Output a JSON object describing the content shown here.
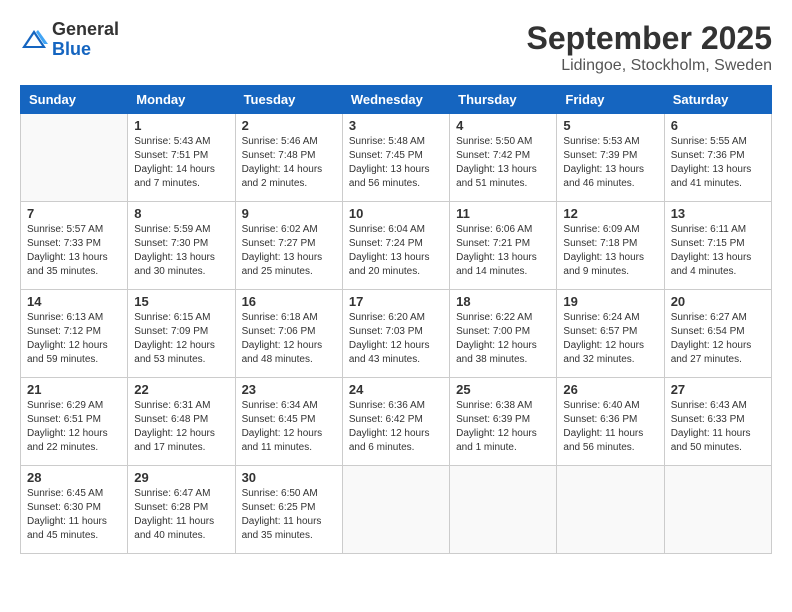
{
  "logo": {
    "general": "General",
    "blue": "Blue"
  },
  "title": "September 2025",
  "location": "Lidingoe, Stockholm, Sweden",
  "weekdays": [
    "Sunday",
    "Monday",
    "Tuesday",
    "Wednesday",
    "Thursday",
    "Friday",
    "Saturday"
  ],
  "weeks": [
    [
      {
        "day": "",
        "sunrise": "",
        "sunset": "",
        "daylight": ""
      },
      {
        "day": "1",
        "sunrise": "Sunrise: 5:43 AM",
        "sunset": "Sunset: 7:51 PM",
        "daylight": "Daylight: 14 hours and 7 minutes."
      },
      {
        "day": "2",
        "sunrise": "Sunrise: 5:46 AM",
        "sunset": "Sunset: 7:48 PM",
        "daylight": "Daylight: 14 hours and 2 minutes."
      },
      {
        "day": "3",
        "sunrise": "Sunrise: 5:48 AM",
        "sunset": "Sunset: 7:45 PM",
        "daylight": "Daylight: 13 hours and 56 minutes."
      },
      {
        "day": "4",
        "sunrise": "Sunrise: 5:50 AM",
        "sunset": "Sunset: 7:42 PM",
        "daylight": "Daylight: 13 hours and 51 minutes."
      },
      {
        "day": "5",
        "sunrise": "Sunrise: 5:53 AM",
        "sunset": "Sunset: 7:39 PM",
        "daylight": "Daylight: 13 hours and 46 minutes."
      },
      {
        "day": "6",
        "sunrise": "Sunrise: 5:55 AM",
        "sunset": "Sunset: 7:36 PM",
        "daylight": "Daylight: 13 hours and 41 minutes."
      }
    ],
    [
      {
        "day": "7",
        "sunrise": "Sunrise: 5:57 AM",
        "sunset": "Sunset: 7:33 PM",
        "daylight": "Daylight: 13 hours and 35 minutes."
      },
      {
        "day": "8",
        "sunrise": "Sunrise: 5:59 AM",
        "sunset": "Sunset: 7:30 PM",
        "daylight": "Daylight: 13 hours and 30 minutes."
      },
      {
        "day": "9",
        "sunrise": "Sunrise: 6:02 AM",
        "sunset": "Sunset: 7:27 PM",
        "daylight": "Daylight: 13 hours and 25 minutes."
      },
      {
        "day": "10",
        "sunrise": "Sunrise: 6:04 AM",
        "sunset": "Sunset: 7:24 PM",
        "daylight": "Daylight: 13 hours and 20 minutes."
      },
      {
        "day": "11",
        "sunrise": "Sunrise: 6:06 AM",
        "sunset": "Sunset: 7:21 PM",
        "daylight": "Daylight: 13 hours and 14 minutes."
      },
      {
        "day": "12",
        "sunrise": "Sunrise: 6:09 AM",
        "sunset": "Sunset: 7:18 PM",
        "daylight": "Daylight: 13 hours and 9 minutes."
      },
      {
        "day": "13",
        "sunrise": "Sunrise: 6:11 AM",
        "sunset": "Sunset: 7:15 PM",
        "daylight": "Daylight: 13 hours and 4 minutes."
      }
    ],
    [
      {
        "day": "14",
        "sunrise": "Sunrise: 6:13 AM",
        "sunset": "Sunset: 7:12 PM",
        "daylight": "Daylight: 12 hours and 59 minutes."
      },
      {
        "day": "15",
        "sunrise": "Sunrise: 6:15 AM",
        "sunset": "Sunset: 7:09 PM",
        "daylight": "Daylight: 12 hours and 53 minutes."
      },
      {
        "day": "16",
        "sunrise": "Sunrise: 6:18 AM",
        "sunset": "Sunset: 7:06 PM",
        "daylight": "Daylight: 12 hours and 48 minutes."
      },
      {
        "day": "17",
        "sunrise": "Sunrise: 6:20 AM",
        "sunset": "Sunset: 7:03 PM",
        "daylight": "Daylight: 12 hours and 43 minutes."
      },
      {
        "day": "18",
        "sunrise": "Sunrise: 6:22 AM",
        "sunset": "Sunset: 7:00 PM",
        "daylight": "Daylight: 12 hours and 38 minutes."
      },
      {
        "day": "19",
        "sunrise": "Sunrise: 6:24 AM",
        "sunset": "Sunset: 6:57 PM",
        "daylight": "Daylight: 12 hours and 32 minutes."
      },
      {
        "day": "20",
        "sunrise": "Sunrise: 6:27 AM",
        "sunset": "Sunset: 6:54 PM",
        "daylight": "Daylight: 12 hours and 27 minutes."
      }
    ],
    [
      {
        "day": "21",
        "sunrise": "Sunrise: 6:29 AM",
        "sunset": "Sunset: 6:51 PM",
        "daylight": "Daylight: 12 hours and 22 minutes."
      },
      {
        "day": "22",
        "sunrise": "Sunrise: 6:31 AM",
        "sunset": "Sunset: 6:48 PM",
        "daylight": "Daylight: 12 hours and 17 minutes."
      },
      {
        "day": "23",
        "sunrise": "Sunrise: 6:34 AM",
        "sunset": "Sunset: 6:45 PM",
        "daylight": "Daylight: 12 hours and 11 minutes."
      },
      {
        "day": "24",
        "sunrise": "Sunrise: 6:36 AM",
        "sunset": "Sunset: 6:42 PM",
        "daylight": "Daylight: 12 hours and 6 minutes."
      },
      {
        "day": "25",
        "sunrise": "Sunrise: 6:38 AM",
        "sunset": "Sunset: 6:39 PM",
        "daylight": "Daylight: 12 hours and 1 minute."
      },
      {
        "day": "26",
        "sunrise": "Sunrise: 6:40 AM",
        "sunset": "Sunset: 6:36 PM",
        "daylight": "Daylight: 11 hours and 56 minutes."
      },
      {
        "day": "27",
        "sunrise": "Sunrise: 6:43 AM",
        "sunset": "Sunset: 6:33 PM",
        "daylight": "Daylight: 11 hours and 50 minutes."
      }
    ],
    [
      {
        "day": "28",
        "sunrise": "Sunrise: 6:45 AM",
        "sunset": "Sunset: 6:30 PM",
        "daylight": "Daylight: 11 hours and 45 minutes."
      },
      {
        "day": "29",
        "sunrise": "Sunrise: 6:47 AM",
        "sunset": "Sunset: 6:28 PM",
        "daylight": "Daylight: 11 hours and 40 minutes."
      },
      {
        "day": "30",
        "sunrise": "Sunrise: 6:50 AM",
        "sunset": "Sunset: 6:25 PM",
        "daylight": "Daylight: 11 hours and 35 minutes."
      },
      {
        "day": "",
        "sunrise": "",
        "sunset": "",
        "daylight": ""
      },
      {
        "day": "",
        "sunrise": "",
        "sunset": "",
        "daylight": ""
      },
      {
        "day": "",
        "sunrise": "",
        "sunset": "",
        "daylight": ""
      },
      {
        "day": "",
        "sunrise": "",
        "sunset": "",
        "daylight": ""
      }
    ]
  ]
}
